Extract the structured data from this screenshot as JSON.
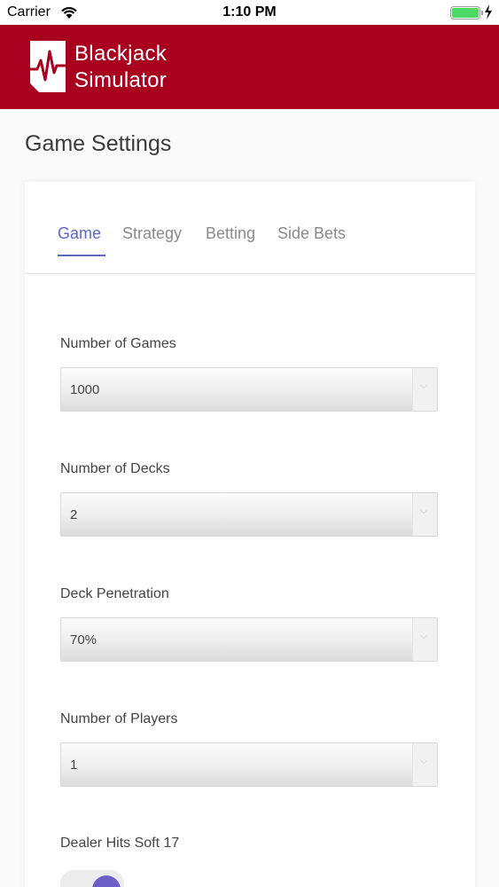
{
  "status_bar": {
    "carrier": "Carrier",
    "time": "1:10 PM",
    "battery_level": 1.0,
    "battery_color": "#4cd964"
  },
  "header": {
    "logo_line1": "Blackjack",
    "logo_line2": "Simulator",
    "background_color": "#a8001e",
    "logo_icon": "heartbeat-card-icon"
  },
  "page": {
    "title": "Game Settings"
  },
  "tabs": [
    {
      "label": "Game",
      "active": true
    },
    {
      "label": "Strategy",
      "active": false
    },
    {
      "label": "Betting",
      "active": false
    },
    {
      "label": "Side Bets",
      "active": false
    }
  ],
  "accent_color": "#5b67c8",
  "fields": {
    "number_of_games": {
      "label": "Number of Games",
      "value": "1000"
    },
    "number_of_decks": {
      "label": "Number of Decks",
      "value": "2"
    },
    "deck_penetration": {
      "label": "Deck Penetration",
      "value": "70%"
    },
    "number_of_players": {
      "label": "Number of Players",
      "value": "1"
    },
    "dealer_hits_soft_17": {
      "label": "Dealer Hits Soft 17",
      "value": true
    }
  },
  "icons": {
    "select_arrow": "chevron-down-icon",
    "wifi": "wifi-icon",
    "charging": "charging-bolt-icon"
  }
}
